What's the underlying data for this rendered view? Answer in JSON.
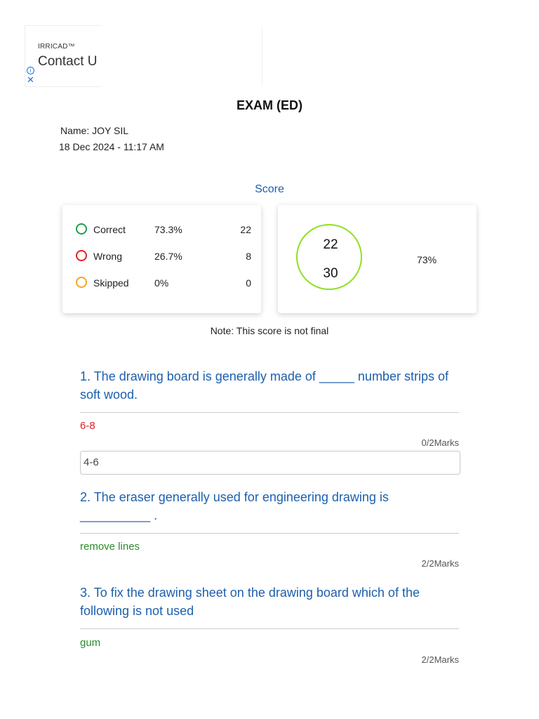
{
  "ad": {
    "brand": "IRRICAD™",
    "cta": "Contact U",
    "info_icon": "info-icon",
    "close_icon": "close-icon"
  },
  "exam": {
    "title": "EXAM (ED)",
    "name_line": "Name:  JOY SIL",
    "datetime": "18 Dec 2024 - 11:17 AM"
  },
  "score": {
    "heading": "Score",
    "stats": [
      {
        "label": "Correct",
        "percent": "73.3%",
        "count": "22",
        "color": "#1e9e4a"
      },
      {
        "label": "Wrong",
        "percent": "26.7%",
        "count": "8",
        "color": "#e02020"
      },
      {
        "label": "Skipped",
        "percent": "0%",
        "count": "0",
        "color": "#f5a623"
      }
    ],
    "obtained": "22",
    "total": "30",
    "percent": "73%",
    "note": "Note: This score is not final"
  },
  "questions": [
    {
      "text": "1. The drawing board is generally made of _____ number strips of soft wood.",
      "answer": "6-8",
      "answer_color": "#e02020",
      "marks": "0/2Marks",
      "correct_answer": "4-6"
    },
    {
      "text": "2. The eraser generally used for engineering drawing is __________ .",
      "answer": "remove lines",
      "answer_color": "#2a8a2a",
      "marks": "2/2Marks"
    },
    {
      "text": "3. To fix the drawing sheet on the drawing board which of the following is not used",
      "answer": "gum",
      "answer_color": "#2a8a2a",
      "marks": "2/2Marks"
    }
  ]
}
